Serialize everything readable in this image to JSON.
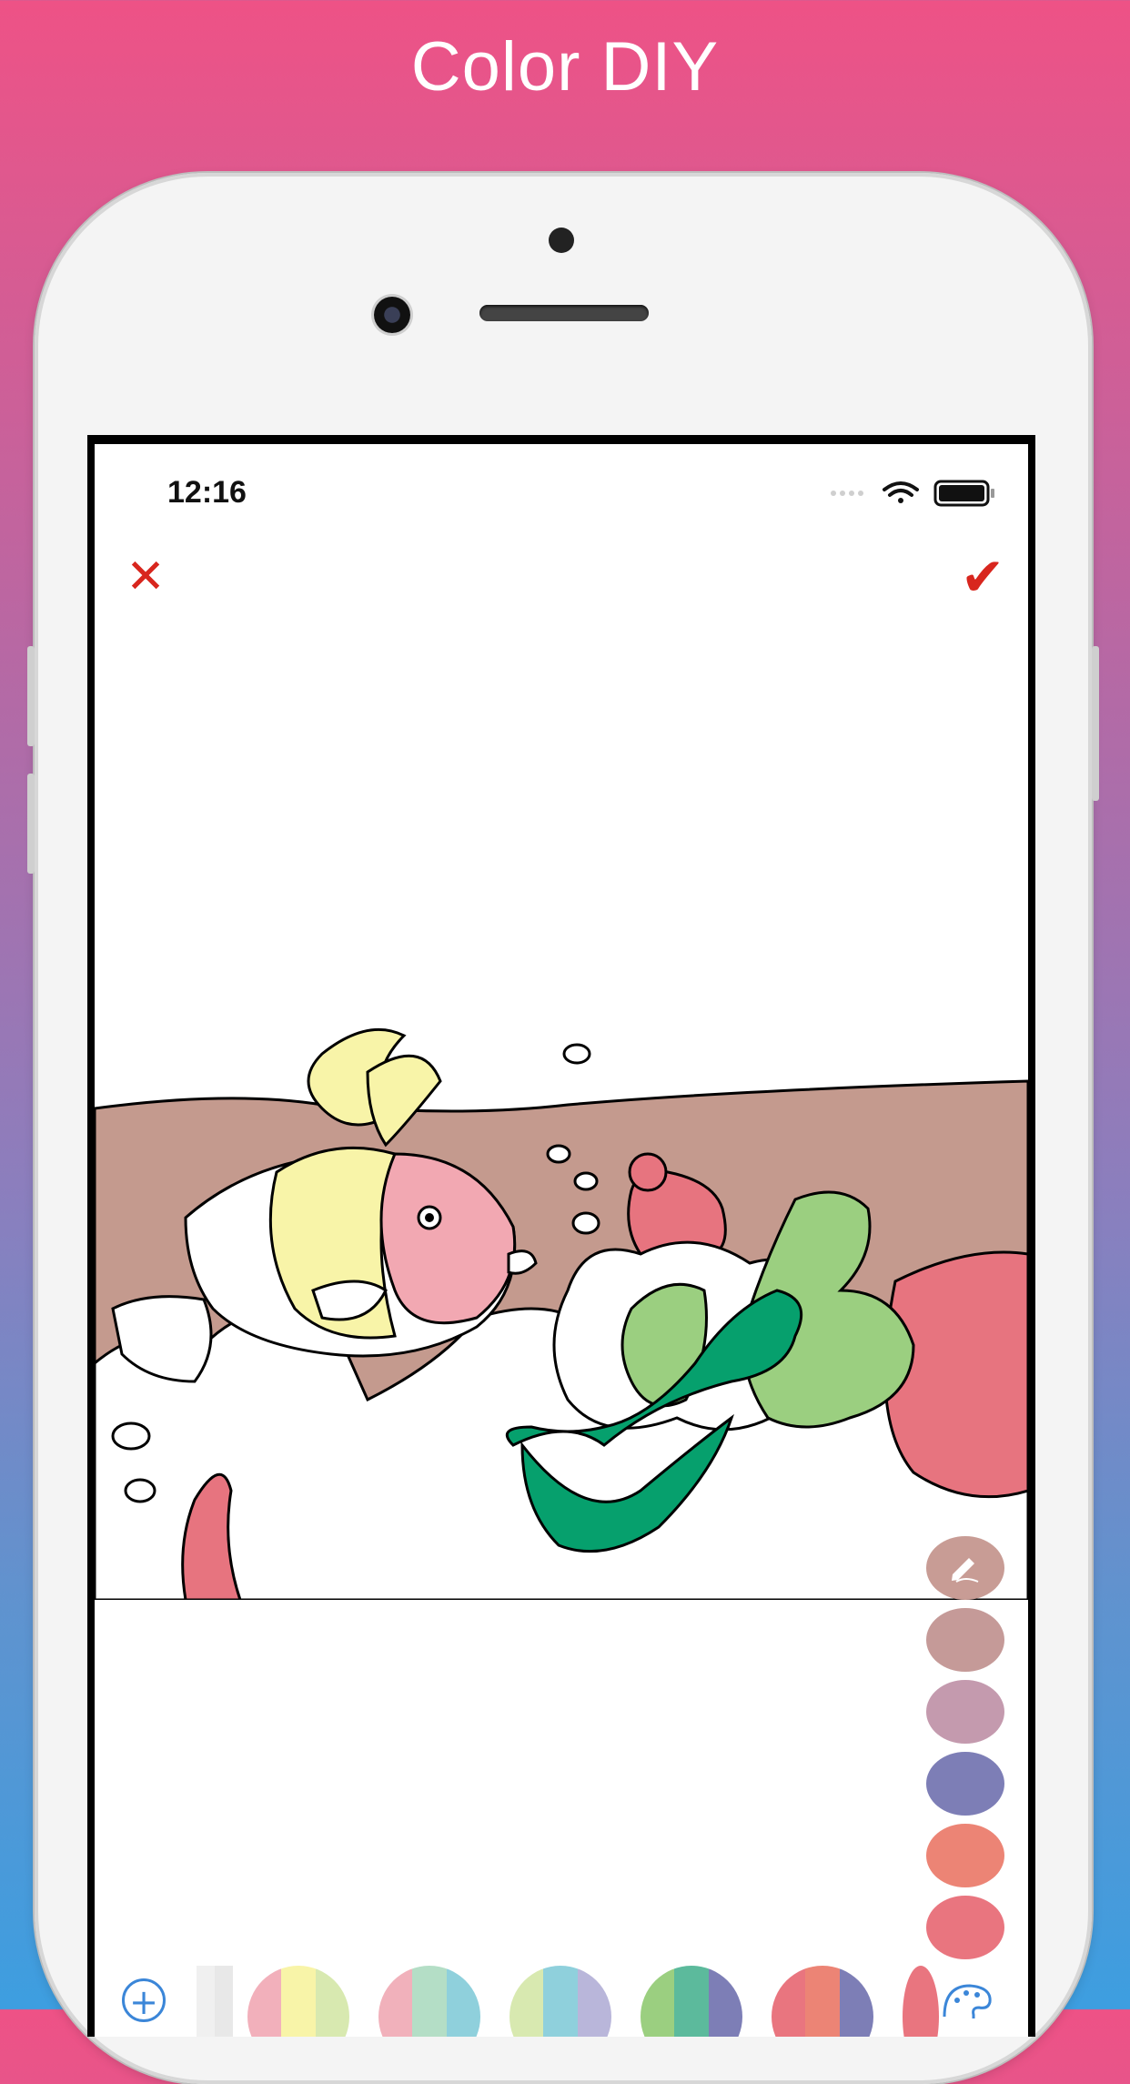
{
  "headline": "Color DIY",
  "status": {
    "time": "12:16"
  },
  "toolbar": {
    "close_icon": "✕",
    "confirm_icon": "✔"
  },
  "colors": {
    "accent_red": "#d8261e",
    "add_button": "#3b86d8",
    "seabed": "#c49a8e",
    "fish_body_yellow": "#f8f4a8",
    "fish_face_pink": "#f2a8b2",
    "coral_red": "#e7747f",
    "seaweed_light": "#9bcf80",
    "seaweed_dark": "#06a06d"
  },
  "picked_colors": [
    {
      "name": "current-pencil",
      "color": "#c89c95",
      "icon": "pencil-icon"
    },
    {
      "name": "dusty-rose",
      "color": "#c59a98"
    },
    {
      "name": "mauve",
      "color": "#c49aae"
    },
    {
      "name": "periwinkle",
      "color": "#7d7eb6"
    },
    {
      "name": "salmon",
      "color": "#ec8475"
    },
    {
      "name": "coral",
      "color": "#e9757f"
    }
  ],
  "palettes": [
    [
      "#f0f0f0",
      "#e8e8e8"
    ],
    [
      "#f2b0bb",
      "#f8f4a8",
      "#d8e9b0"
    ],
    [
      "#f1b1bb",
      "#b4dec6",
      "#8fd0dc"
    ],
    [
      "#d8e9b0",
      "#8fd0dc",
      "#b9b6da"
    ],
    [
      "#9bcf80",
      "#5cba9c",
      "#7d7eb6"
    ],
    [
      "#e9757f",
      "#ec8475",
      "#7d7eb6"
    ],
    [
      "#e9757f"
    ]
  ]
}
